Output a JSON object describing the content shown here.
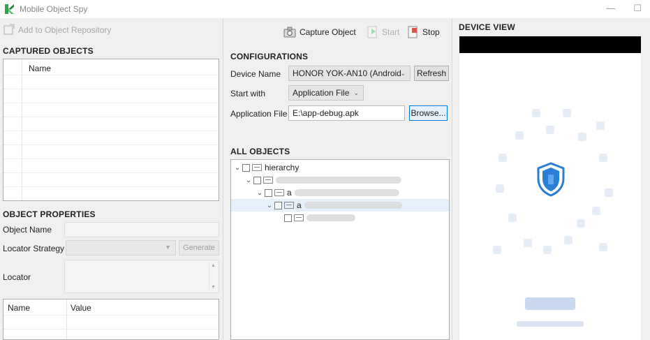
{
  "window": {
    "title": "Mobile Object Spy",
    "minimize_glyph": "—",
    "maximize_glyph": "☐"
  },
  "left_panel": {
    "add_to_repository": "Add to Object Repository",
    "captured_objects_title": "CAPTURED OBJECTS",
    "captured_table_header": "Name",
    "object_properties_title": "OBJECT PROPERTIES",
    "object_name_label": "Object Name",
    "locator_strategy_label": "Locator Strategy",
    "generate_label": "Generate",
    "locator_label": "Locator",
    "props_table_headers": [
      "Name",
      "Value"
    ]
  },
  "middle_panel": {
    "toolbar": {
      "capture_object": "Capture Object",
      "start": "Start",
      "stop": "Stop"
    },
    "configurations_title": "CONFIGURATIONS",
    "device_name_label": "Device Name",
    "device_name_value": "HONOR YOK-AN10 (Android",
    "refresh_label": "Refresh",
    "start_with_label": "Start with",
    "start_with_value": "Application File",
    "application_file_label": "Application File",
    "application_file_value": "E:\\app-debug.apk",
    "browse_label": "Browse...",
    "all_objects_title": "ALL OBJECTS",
    "tree": {
      "root_label": "hierarchy",
      "level2_label": "a",
      "level3_label": "a"
    }
  },
  "right_panel": {
    "device_view_title": "DEVICE VIEW"
  },
  "colors": {
    "accent": "#0078d7",
    "shield": "#2a7fd4",
    "selection": "#e6f0fa"
  },
  "icons": [
    "app-logo-icon",
    "add-repository-icon",
    "capture-icon",
    "start-icon",
    "stop-icon",
    "chevron-down-icon",
    "shield-icon",
    "node-icon",
    "checkbox-icon"
  ]
}
